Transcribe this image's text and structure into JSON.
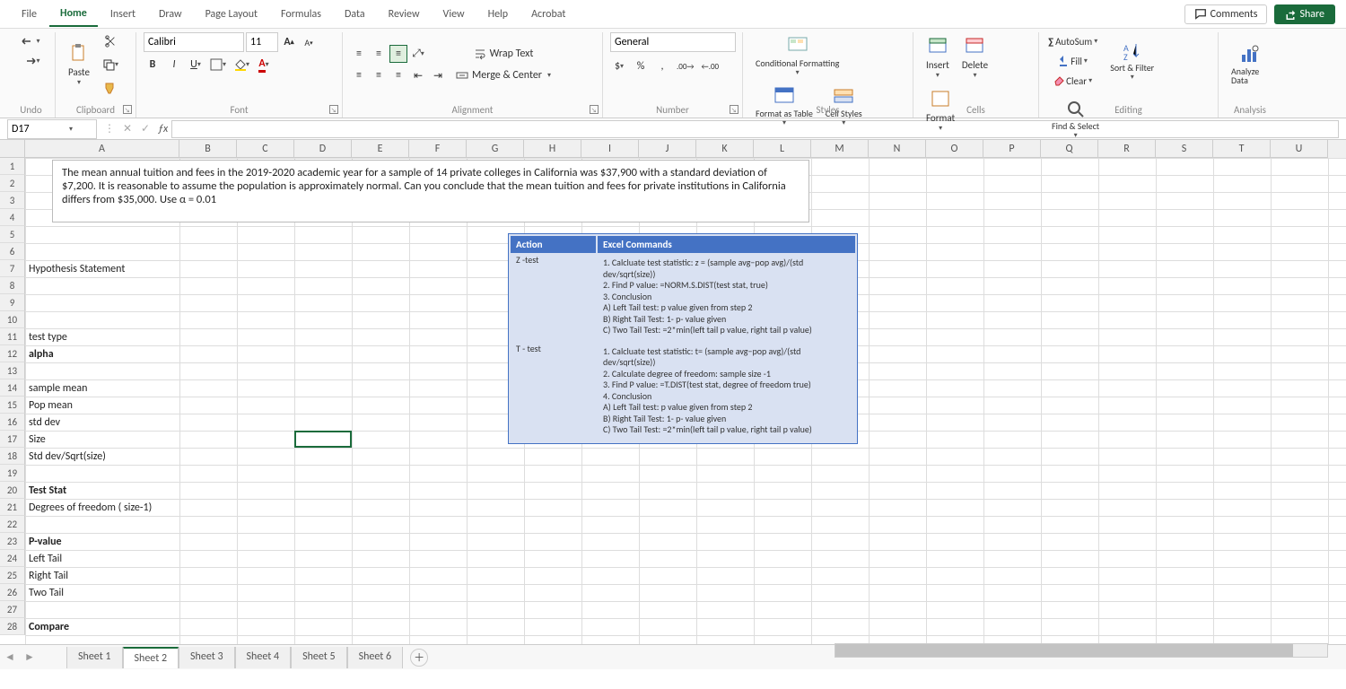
{
  "menu": {
    "tabs": [
      "File",
      "Home",
      "Insert",
      "Draw",
      "Page Layout",
      "Formulas",
      "Data",
      "Review",
      "View",
      "Help",
      "Acrobat"
    ],
    "active": "Home",
    "comments": "Comments",
    "share": "Share"
  },
  "ribbon": {
    "undo": "Undo",
    "clipboard": "Clipboard",
    "paste": "Paste",
    "font": "Font",
    "fontName": "Calibri",
    "fontSize": "11",
    "alignment": "Alignment",
    "wrap": "Wrap Text",
    "merge": "Merge & Center",
    "number": "Number",
    "numFormat": "General",
    "styles": "Styles",
    "cond": "Conditional Formatting",
    "formatTable": "Format as Table",
    "cellStyles": "Cell Styles",
    "cells": "Cells",
    "insert": "Insert",
    "delete": "Delete",
    "format": "Format",
    "editing": "Editing",
    "autosum": "AutoSum",
    "fill": "Fill",
    "clear": "Clear",
    "sort": "Sort & Filter",
    "find": "Find & Select",
    "analysis": "Analysis",
    "analyze": "Analyze Data"
  },
  "nameBox": "D17",
  "columns": [
    "A",
    "B",
    "C",
    "D",
    "E",
    "F",
    "G",
    "H",
    "I",
    "J",
    "K",
    "L",
    "M",
    "N",
    "O",
    "P",
    "Q",
    "R",
    "S",
    "T",
    "U"
  ],
  "colWidths": {
    "A": 172,
    "default": 64
  },
  "rowCount": 28,
  "problemText": "The mean annual tuition and fees in the 2019-2020 academic year for a sample of 14 private colleges in California was $37,900 with a standard deviation of $7,200. It is reasonable to assume the population is approximately normal. Can you conclude that the mean tuition and fees for private institutions in California differs from $35,000. Use α = 0.01",
  "cells": [
    {
      "row": 7,
      "colA": "Hypothesis Statement"
    },
    {
      "row": 11,
      "colA": "test type"
    },
    {
      "row": 12,
      "colA": "alpha",
      "bold": true
    },
    {
      "row": 14,
      "colA": "sample mean"
    },
    {
      "row": 15,
      "colA": "Pop mean"
    },
    {
      "row": 16,
      "colA": " std dev"
    },
    {
      "row": 17,
      "colA": "Size"
    },
    {
      "row": 18,
      "colA": "Std dev/Sqrt(size)"
    },
    {
      "row": 20,
      "colA": "Test Stat",
      "bold": true
    },
    {
      "row": 21,
      "colA": "Degrees of freedom ( size-1)"
    },
    {
      "row": 23,
      "colA": "P-value",
      "bold": true
    },
    {
      "row": 24,
      "colA": "Left Tail"
    },
    {
      "row": 25,
      "colA": "Right Tail"
    },
    {
      "row": 26,
      "colA": "Two Tail"
    },
    {
      "row": 28,
      "colA": "Compare",
      "bold": true
    }
  ],
  "instr": {
    "h1": "Action",
    "h2": "Excel Commands",
    "r1": "Z -test",
    "r1c": "1.   Calcluate  test statistic: z = (sample avg−pop avg)/(std dev/sqrt(size))\n2.   Find P value: =NORM.S.DIST(test stat, true)\n3.   Conclusion\n       A) Left Tail test: p value given from step 2\n       B) Right Tail Test: 1- p- value given\n       C) Two Tail Test: =2*min(left tail p value, right tail p value)",
    "r2": "T - test",
    "r2c": "1.   Calcluate  test statistic: t= (sample avg−pop avg)/(std dev/sqrt(size))\n2.   Calculate degree of freedom: sample size -1\n3.   Find P value: =T.DIST(test stat, degree of freedom true)\n4.   Conclusion\n       A) Left Tail test: p value given from step 2\n       B) Right Tail Test: 1- p- value given\n       C) Two Tail Test: =2*min(left tail p value, right tail p value)"
  },
  "sheets": [
    "Sheet 1",
    "Sheet 2",
    "Sheet 3",
    "Sheet 4",
    "Sheet 5",
    "Sheet 6"
  ],
  "activeSheet": "Sheet 2"
}
